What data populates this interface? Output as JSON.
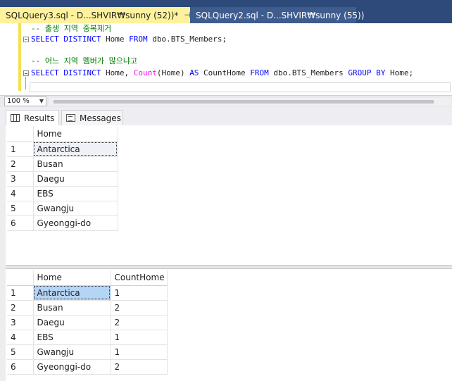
{
  "tabs": [
    {
      "label": "SQLQuery3.sql - D...SHVIR₩sunny (52))*",
      "pin": "⊣",
      "close": "✕"
    },
    {
      "label": "SQLQuery2.sql - D...SHVIR₩sunny (55))"
    }
  ],
  "editor": {
    "comment1": "-- 출생 지역 중복제거",
    "q1_select": "SELECT DISTINCT",
    "q1_col": " Home ",
    "q1_from": "FROM",
    "q1_table": " dbo.BTS_Members;",
    "comment2": "-- 어느 지역 멤버가 많으냐고",
    "q2_select": "SELECT DISTINCT",
    "q2_col": " Home, ",
    "q2_count": "Count",
    "q2_arg": "(Home) ",
    "q2_as": "AS",
    "q2_alias": " CountHome ",
    "q2_from": "FROM",
    "q2_table": " dbo.BTS_Members ",
    "q2_group": "GROUP BY",
    "q2_tail": " Home;"
  },
  "zoom": {
    "value": "100 %"
  },
  "results_tabs": {
    "results": "Results",
    "messages": "Messages"
  },
  "grid1": {
    "headers": [
      "Home"
    ],
    "rows": [
      {
        "n": "1",
        "home": "Antarctica"
      },
      {
        "n": "2",
        "home": "Busan"
      },
      {
        "n": "3",
        "home": "Daegu"
      },
      {
        "n": "4",
        "home": "EBS"
      },
      {
        "n": "5",
        "home": "Gwangju"
      },
      {
        "n": "6",
        "home": "Gyeonggi-do"
      }
    ]
  },
  "grid2": {
    "headers": [
      "Home",
      "CountHome"
    ],
    "rows": [
      {
        "n": "1",
        "home": "Antarctica",
        "count": "1"
      },
      {
        "n": "2",
        "home": "Busan",
        "count": "2"
      },
      {
        "n": "3",
        "home": "Daegu",
        "count": "2"
      },
      {
        "n": "4",
        "home": "EBS",
        "count": "1"
      },
      {
        "n": "5",
        "home": "Gwangju",
        "count": "1"
      },
      {
        "n": "6",
        "home": "Gyeonggi-do",
        "count": "2"
      }
    ]
  },
  "colors": {
    "tab_active": "#fff29d",
    "tab_strip": "#2e4a7a",
    "keyword": "#0000ff",
    "function": "#ff00ff",
    "comment": "#008000",
    "selection": "#b4d5f5"
  }
}
